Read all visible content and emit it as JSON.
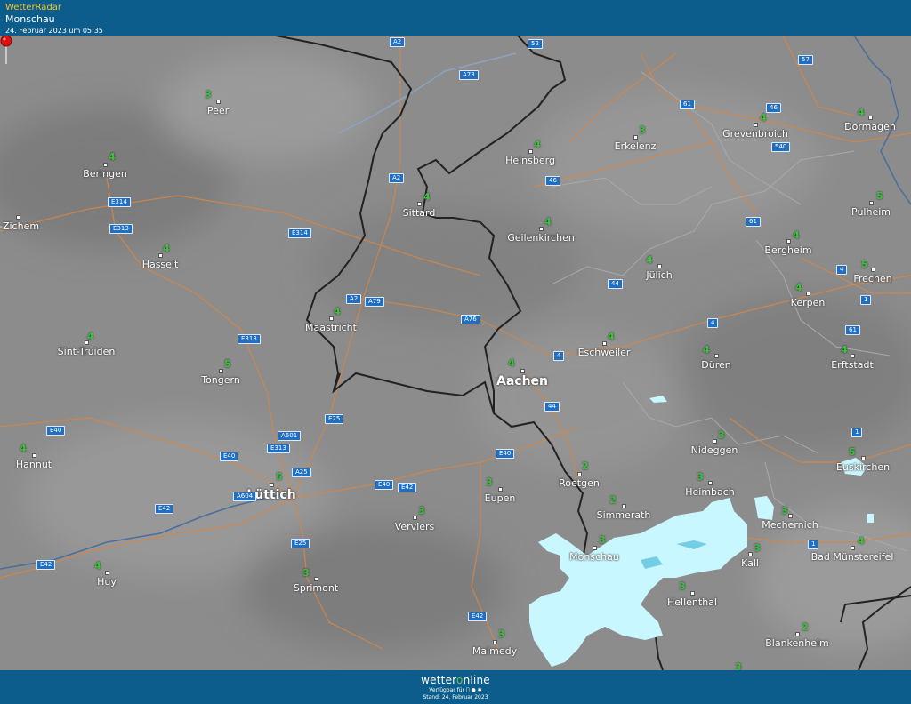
{
  "header": {
    "app_name": "WetterRadar",
    "location": "Monschau",
    "timestamp": "24. Februar 2023 um 05:35"
  },
  "footer": {
    "brand_prefix": "wetter",
    "brand_o": "o",
    "brand_suffix": "nline",
    "available": "Verfügbar für",
    "status": "Stand: 24. Februar 2023"
  },
  "colors": {
    "header_bg": "#0d5d8c",
    "map_bg": "#8c8c8c",
    "border": "#222222",
    "roads": "#d2874a",
    "river": "#4a6e9a",
    "rain_light": "#c8f7ff",
    "rain_medium": "#74cde6",
    "value_text": "#3bc23b",
    "pin": "#dd1111"
  },
  "map": {
    "cities": [
      {
        "name": "Peer"
      },
      {
        "name": "Beringen"
      },
      {
        "name": "l-Zichem"
      },
      {
        "name": "Hasselt"
      },
      {
        "name": "Sint-Truiden"
      },
      {
        "name": "Tongern"
      },
      {
        "name": "Hannut"
      },
      {
        "name": "Lüttich"
      },
      {
        "name": "Huy"
      },
      {
        "name": "Sprimont"
      },
      {
        "name": "Verviers"
      },
      {
        "name": "Eupen"
      },
      {
        "name": "Malmedy"
      },
      {
        "name": "Maastricht"
      },
      {
        "name": "Sittard"
      },
      {
        "name": "Heinsberg"
      },
      {
        "name": "Erkelenz"
      },
      {
        "name": "Geilenkirchen"
      },
      {
        "name": "Jülich"
      },
      {
        "name": "Aachen"
      },
      {
        "name": "Eschweiler"
      },
      {
        "name": "Düren"
      },
      {
        "name": "Roetgen"
      },
      {
        "name": "Simmerath"
      },
      {
        "name": "Monschau"
      },
      {
        "name": "Nideggen"
      },
      {
        "name": "Heimbach"
      },
      {
        "name": "Hellenthal"
      },
      {
        "name": "Kall"
      },
      {
        "name": "Mechernich"
      },
      {
        "name": "Euskirchen"
      },
      {
        "name": "Bad Münstereifel"
      },
      {
        "name": "Blankenheim"
      },
      {
        "name": "Erftstadt"
      },
      {
        "name": "Kerpen"
      },
      {
        "name": "Frechen"
      },
      {
        "name": "Bergheim"
      },
      {
        "name": "Pulheim"
      },
      {
        "name": "Grevenbroich"
      },
      {
        "name": "Dormagen"
      }
    ],
    "values": [
      "3",
      "4",
      "4",
      "4",
      "5",
      "4",
      "5",
      "4",
      "3",
      "3",
      "3",
      "3",
      "4",
      "4",
      "4",
      "3",
      "4",
      "4",
      "4",
      "4",
      "4",
      "2",
      "2",
      "3",
      "3",
      "3",
      "3",
      "3",
      "3",
      "5",
      "4",
      "2",
      "4",
      "4",
      "5",
      "4",
      "5",
      "4",
      "4",
      "3"
    ],
    "roads": [
      "A2",
      "A73",
      "52",
      "57",
      "61",
      "46",
      "540",
      "46",
      "A2",
      "E314",
      "E313",
      "E314",
      "4",
      "61",
      "A2",
      "A79",
      "A76",
      "4",
      "44",
      "4",
      "1",
      "61",
      "4",
      "E313",
      "E25",
      "A601",
      "E313",
      "E40",
      "E40",
      "A25",
      "A604",
      "E40",
      "E42",
      "E40",
      "E42",
      "E25",
      "E42",
      "1",
      "1",
      "E42",
      "44"
    ]
  }
}
